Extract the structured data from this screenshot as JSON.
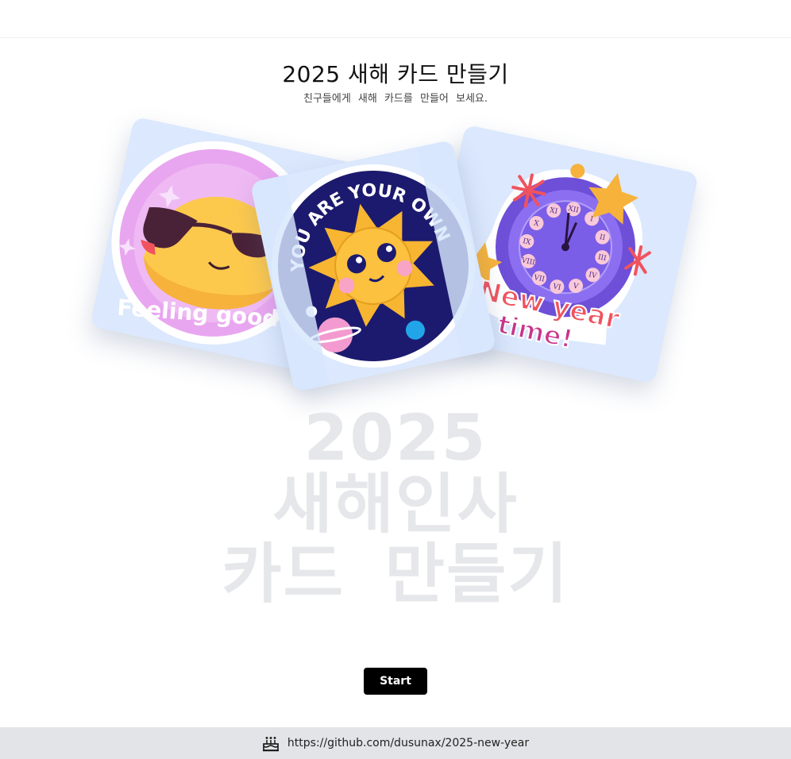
{
  "header": {
    "title": "2025 새해 카드 만들기",
    "subtitle": "친구들에게 새해 카드를 만들어 보세요."
  },
  "cards": [
    {
      "sticker": "Feeling good",
      "icon": "sunglasses-emoji-icon"
    },
    {
      "sticker": "YOU ARE YOUR OWN",
      "icon": "sun-face-icon"
    },
    {
      "sticker_line1": "New year",
      "sticker_line2": "time!",
      "icon": "clock-icon"
    }
  ],
  "hero": {
    "line1": "2025",
    "line2": "새해인사",
    "line3": "카드 만들기"
  },
  "actions": {
    "start_label": "Start"
  },
  "footer": {
    "link_text": "https://github.com/dusunax/2025-new-year",
    "icon": "cake-icon"
  },
  "colors": {
    "accent": "#000000",
    "card_bg": "#dbe8fd",
    "hero_text": "#e6e7ea",
    "footer_bg": "#e3e4e7"
  }
}
